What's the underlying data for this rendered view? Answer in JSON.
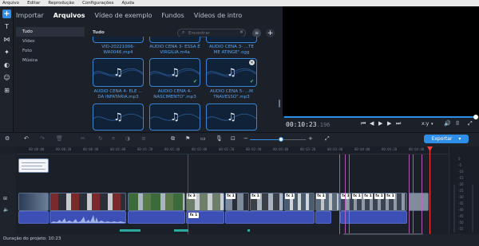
{
  "menu": [
    "Arquivo",
    "Editar",
    "Reprodução",
    "Configurações",
    "Ajuda"
  ],
  "tabs": [
    {
      "label": "Importar",
      "active": false
    },
    {
      "label": "Arquivos",
      "active": true
    },
    {
      "label": "Vídeo de exemplo",
      "active": false
    },
    {
      "label": "Fundos",
      "active": false
    },
    {
      "label": "Vídeos de intro",
      "active": false
    }
  ],
  "categories": [
    {
      "label": "Tudo",
      "active": true
    },
    {
      "label": "Vídeo",
      "active": false
    },
    {
      "label": "Foto",
      "active": false
    },
    {
      "label": "Música",
      "active": false
    }
  ],
  "media": {
    "title": "Tudo",
    "search_placeholder": "Encontrar",
    "items": [
      {
        "caption": "VID-20221006-WA0046.mp4",
        "type": "video"
      },
      {
        "caption": "AUDIO CENA 3- ESSA É VIRGILIA.m4a",
        "type": "audio"
      },
      {
        "caption": "AUDIO CENA 3- ...TE ME ATINGE\".ogg",
        "type": "audio"
      },
      {
        "caption": "AUDIO CENA 4- ELE ... DA INFATARIA.mp3",
        "type": "audio",
        "checked": false
      },
      {
        "caption": "AUDIO CENA 4- NASCIMENTO\".mp3",
        "type": "audio",
        "checked": true
      },
      {
        "caption": "AUDIO CENA 5- ...M TRAVESSO\".mp3",
        "type": "audio",
        "checked": true,
        "removable": true
      },
      {
        "caption": "",
        "type": "audio"
      },
      {
        "caption": "",
        "type": "audio"
      },
      {
        "caption": "",
        "type": "audio"
      }
    ]
  },
  "player": {
    "timecode": "00:10:23",
    "timecode_ms": ".196",
    "aspect": "x:y",
    "progress": 1.0
  },
  "timeline": {
    "ruler_labels": [
      "00:00:00",
      "00:00:20",
      "00:00:40",
      "00:01:00",
      "00:01:20",
      "00:01:40",
      "00:02:00",
      "00:02:20",
      "00:02:40",
      "00:03:00",
      "00:03:20",
      "00:03:40",
      "00:04:00",
      "00:04:20",
      "00:04:40",
      "00:05:00"
    ],
    "export_label": "Exportar",
    "zoom_level": 0.55,
    "fx_label": "fx",
    "fx_video_numbers": [
      "1",
      "1",
      "3",
      "1",
      "1",
      "1",
      "1",
      "1",
      "1",
      "1",
      "1",
      "1"
    ],
    "fx_audio_number": "1",
    "db_labels": [
      "0",
      "-5",
      "-10",
      "-15",
      "-20",
      "-25",
      "-30",
      "-35",
      "-40",
      "-45",
      "-50",
      "-55"
    ]
  },
  "status": {
    "text": "Duração do projeto: 10:23"
  },
  "colors": {
    "accent": "#2f8fe8",
    "marker": "#c864c8",
    "playhead": "#ff3b3b",
    "audio_clip": "#3b4fb4"
  }
}
